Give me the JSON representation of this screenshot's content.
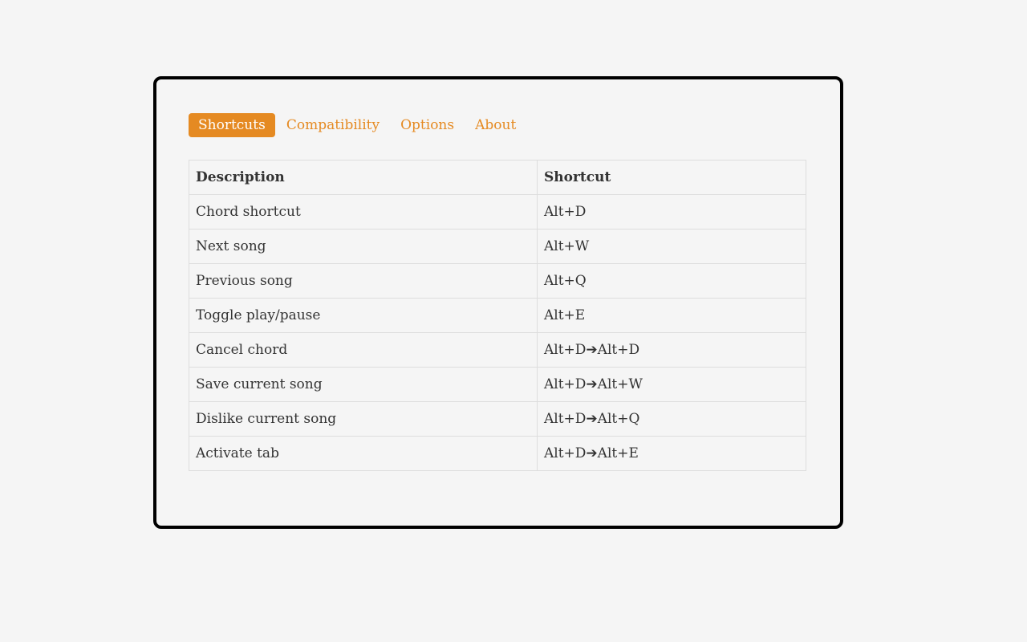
{
  "tabs": [
    {
      "label": "Shortcuts",
      "active": true
    },
    {
      "label": "Compatibility",
      "active": false
    },
    {
      "label": "Options",
      "active": false
    },
    {
      "label": "About",
      "active": false
    }
  ],
  "table": {
    "headers": [
      "Description",
      "Shortcut"
    ],
    "rows": [
      {
        "description": "Chord shortcut",
        "shortcut": "Alt+D"
      },
      {
        "description": "Next song",
        "shortcut": "Alt+W"
      },
      {
        "description": "Previous song",
        "shortcut": "Alt+Q"
      },
      {
        "description": "Toggle play/pause",
        "shortcut": "Alt+E"
      },
      {
        "description": "Cancel chord",
        "shortcut": "Alt+D➔Alt+D"
      },
      {
        "description": "Save current song",
        "shortcut": "Alt+D➔Alt+W"
      },
      {
        "description": "Dislike current song",
        "shortcut": "Alt+D➔Alt+Q"
      },
      {
        "description": "Activate tab",
        "shortcut": "Alt+D➔Alt+E"
      }
    ]
  },
  "colors": {
    "accent": "#e58a22",
    "background": "#f5f5f5",
    "border": "#dddddd",
    "text": "#333333"
  }
}
